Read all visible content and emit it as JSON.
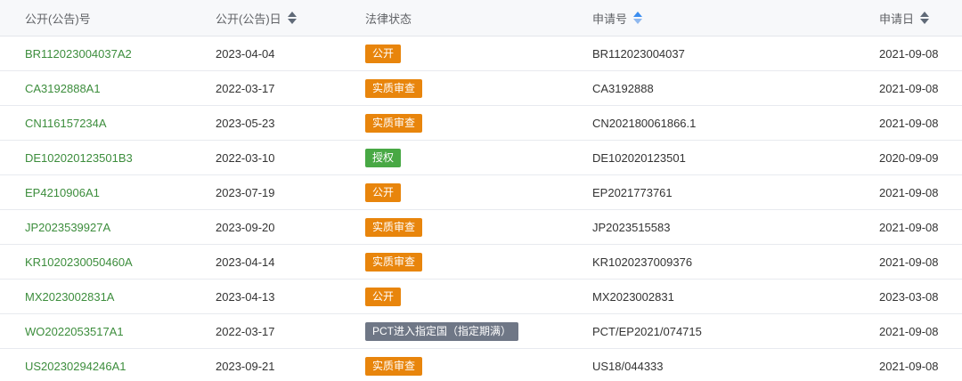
{
  "header": {
    "col_pub_no": "公开(公告)号",
    "col_pub_date": "公开(公告)日",
    "col_legal_status": "法律状态",
    "col_app_no": "申请号",
    "col_app_date": "申请日",
    "sort_icons": [
      "sort-icon",
      "sort-icon-active",
      "sort-icon"
    ]
  },
  "colors": {
    "link": "#3c8d3c",
    "badge_orange": "#e8850c",
    "badge_green": "#48a844",
    "badge_gray": "#6f7786",
    "sort_active": "#3b8ef0"
  },
  "rows": [
    {
      "pub_no": "BR112023004037A2",
      "pub_date": "2023-04-04",
      "status": "公开",
      "status_color": "orange",
      "app_no": "BR112023004037",
      "app_date": "2021-09-08"
    },
    {
      "pub_no": "CA3192888A1",
      "pub_date": "2022-03-17",
      "status": "实质审查",
      "status_color": "orange",
      "app_no": "CA3192888",
      "app_date": "2021-09-08"
    },
    {
      "pub_no": "CN116157234A",
      "pub_date": "2023-05-23",
      "status": "实质审查",
      "status_color": "orange",
      "app_no": "CN202180061866.1",
      "app_date": "2021-09-08"
    },
    {
      "pub_no": "DE102020123501B3",
      "pub_date": "2022-03-10",
      "status": "授权",
      "status_color": "green",
      "app_no": "DE102020123501",
      "app_date": "2020-09-09"
    },
    {
      "pub_no": "EP4210906A1",
      "pub_date": "2023-07-19",
      "status": "公开",
      "status_color": "orange",
      "app_no": "EP2021773761",
      "app_date": "2021-09-08"
    },
    {
      "pub_no": "JP2023539927A",
      "pub_date": "2023-09-20",
      "status": "实质审查",
      "status_color": "orange",
      "app_no": "JP2023515583",
      "app_date": "2021-09-08"
    },
    {
      "pub_no": "KR1020230050460A",
      "pub_date": "2023-04-14",
      "status": "实质审查",
      "status_color": "orange",
      "app_no": "KR1020237009376",
      "app_date": "2021-09-08"
    },
    {
      "pub_no": "MX2023002831A",
      "pub_date": "2023-04-13",
      "status": "公开",
      "status_color": "orange",
      "app_no": "MX2023002831",
      "app_date": "2023-03-08"
    },
    {
      "pub_no": "WO2022053517A1",
      "pub_date": "2022-03-17",
      "status": "PCT进入指定国（指定期满）",
      "status_color": "gray",
      "app_no": "PCT/EP2021/074715",
      "app_date": "2021-09-08"
    },
    {
      "pub_no": "US20230294246A1",
      "pub_date": "2023-09-21",
      "status": "实质审查",
      "status_color": "orange",
      "app_no": "US18/044333",
      "app_date": "2021-09-08"
    }
  ]
}
